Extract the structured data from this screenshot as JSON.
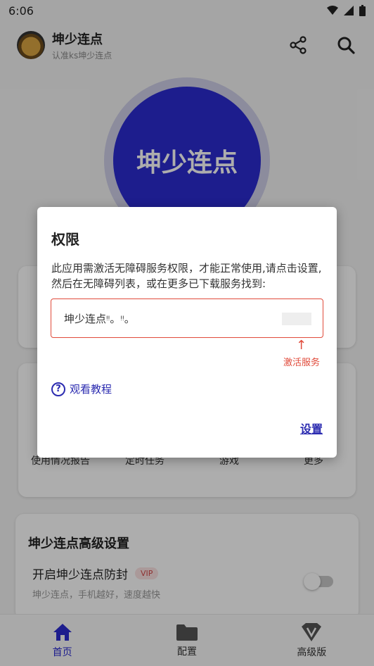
{
  "status_bar": {
    "time": "6:06"
  },
  "app_bar": {
    "title": "坤少连点",
    "subtitle": "认准ks坤少连点",
    "share_icon": "share-icon",
    "search_icon": "search-icon"
  },
  "hero": {
    "label": "坤少连点"
  },
  "grid": {
    "items": [
      "使用情况报告",
      "定时任务",
      "游戏",
      "更多"
    ]
  },
  "advanced": {
    "title": "坤少连点高级设置",
    "row_label": "开启坤少连点防封",
    "vip_badge": "VIP",
    "description": "坤少连点，手机越好，速度越快",
    "toggle_on": false
  },
  "bottom_nav": {
    "items": [
      {
        "label": "首页",
        "icon": "home-icon",
        "active": true
      },
      {
        "label": "配置",
        "icon": "folder-icon",
        "active": false
      },
      {
        "label": "高级版",
        "icon": "vip-v-icon",
        "active": false
      }
    ]
  },
  "dialog": {
    "title": "权限",
    "message": "此应用需激活无障碍服务权限，才能正常使用,请点击设置,然后在无障碍列表，或在更多已下载服务找到:",
    "service_name": "坤少连点ᵎᵎ。ᵎᵎ。",
    "arrow": "↑",
    "activate_hint": "激活服务",
    "tutorial_label": "观看教程",
    "settings_button": "设置"
  },
  "colors": {
    "accent": "#2b2bd0",
    "warning": "#e04a3a",
    "vip_text": "#d14a4a"
  }
}
